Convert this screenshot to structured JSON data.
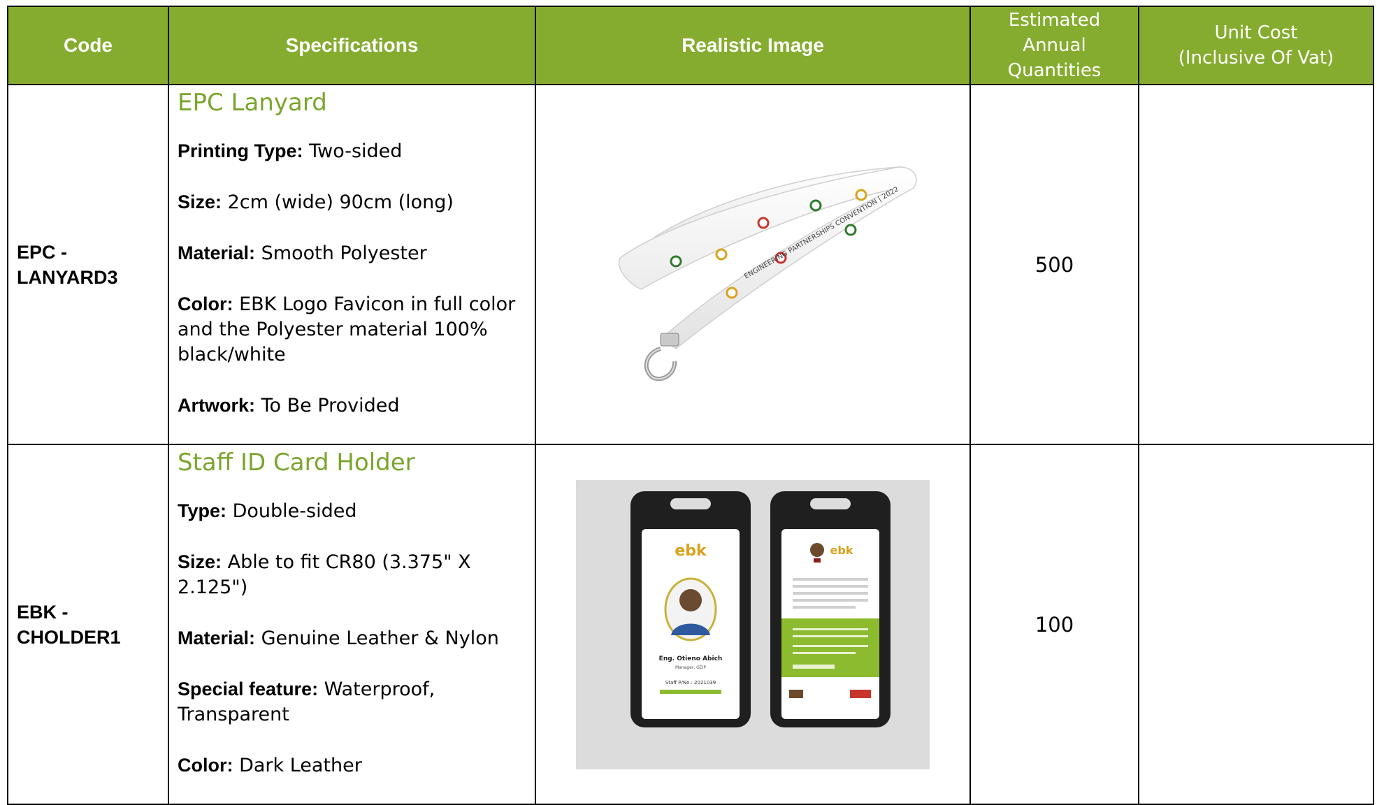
{
  "header": {
    "code": "Code",
    "specifications": "Specifications",
    "realistic_image": "Realistic Image",
    "qty_line1": "Estimated",
    "qty_line2": "Annual",
    "qty_line3": "Quantities",
    "cost_line1": "Unit Cost",
    "cost_line2": "(Inclusive Of Vat)"
  },
  "rows": [
    {
      "code_line1": "EPC -",
      "code_line2": "LANYARD3",
      "title": "EPC Lanyard",
      "specs": [
        {
          "key": "Printing Type:",
          "value": " Two-sided"
        },
        {
          "key": "Size:",
          "value": " 2cm (wide) 90cm (long)"
        },
        {
          "key": "Material:",
          "value": " Smooth Polyester"
        },
        {
          "key": "Color:",
          "value": " EBK Logo Favicon in full color and the Polyester material 100% black/white"
        },
        {
          "key": "Artwork:",
          "value": " To Be Provided"
        }
      ],
      "image_icon": "lanyard-image",
      "image_text": "ENGINEERING PARTNERSHIPS CONVENTION | 2022",
      "quantity": "500",
      "unit_cost": ""
    },
    {
      "code_line1": "EBK -",
      "code_line2": "CHOLDER1",
      "title": "Staff ID Card Holder",
      "specs": [
        {
          "key": "Type:",
          "value": " Double-sided"
        },
        {
          "key": "Size:",
          "value": " Able to fit CR80 (3.375\" X 2.125\")"
        },
        {
          "key": "Material:",
          "value": " Genuine Leather & Nylon"
        },
        {
          "key": "Special feature:",
          "value": " Waterproof, Transparent"
        },
        {
          "key": "Color:",
          "value": " Dark Leather"
        }
      ],
      "image_icon": "id-card-holder-image",
      "card_name": "Eng. Otieno Abich",
      "card_role": "Manager, GEIP",
      "card_staff_no": "Staff P/No.: 2021039",
      "quantity": "100",
      "unit_cost": ""
    }
  ],
  "colors": {
    "header_bg": "#86ac2f",
    "title_green": "#7aa52c"
  }
}
